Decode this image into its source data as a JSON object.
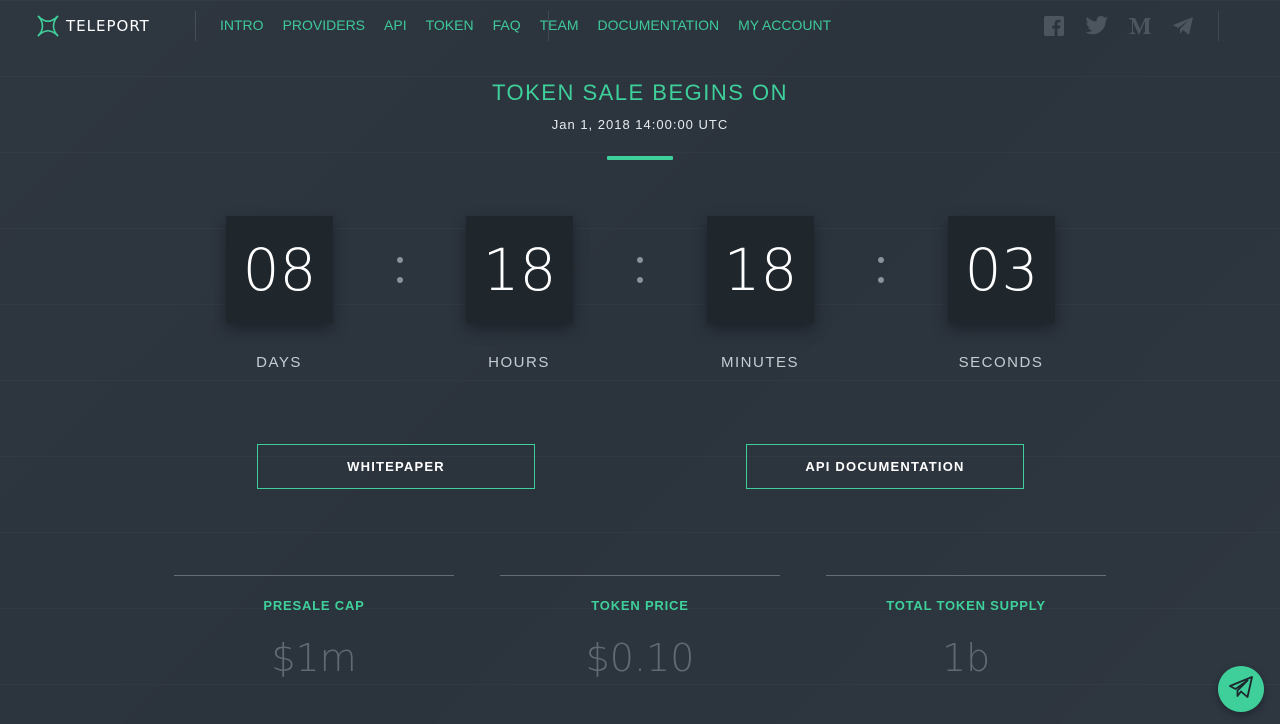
{
  "header": {
    "logo_text": "TELEPORT",
    "nav": [
      "INTRO",
      "PROVIDERS",
      "API",
      "TOKEN",
      "FAQ",
      "TEAM",
      "DOCUMENTATION",
      "MY ACCOUNT"
    ],
    "socials": [
      "facebook-icon",
      "twitter-icon",
      "medium-icon",
      "telegram-icon"
    ]
  },
  "hero": {
    "title": "TOKEN SALE BEGINS ON",
    "date": "Jan 1, 2018 14:00:00 UTC"
  },
  "countdown": {
    "days": "08",
    "hours": "18",
    "minutes": "18",
    "seconds": "03",
    "labels": {
      "days": "DAYS",
      "hours": "HOURS",
      "minutes": "MINUTES",
      "seconds": "SECONDS"
    }
  },
  "buttons": {
    "whitepaper": "WHITEPAPER",
    "api_docs": "API DOCUMENTATION"
  },
  "stats": [
    {
      "label": "PRESALE CAP",
      "value": "$1m"
    },
    {
      "label": "TOKEN PRICE",
      "value": "$0.10"
    },
    {
      "label": "TOTAL TOKEN SUPPLY",
      "value": "1b"
    }
  ],
  "colors": {
    "accent": "#3ecf9a",
    "background": "#2b333d",
    "box": "#1f262c"
  },
  "fab_icon": "telegram-icon"
}
